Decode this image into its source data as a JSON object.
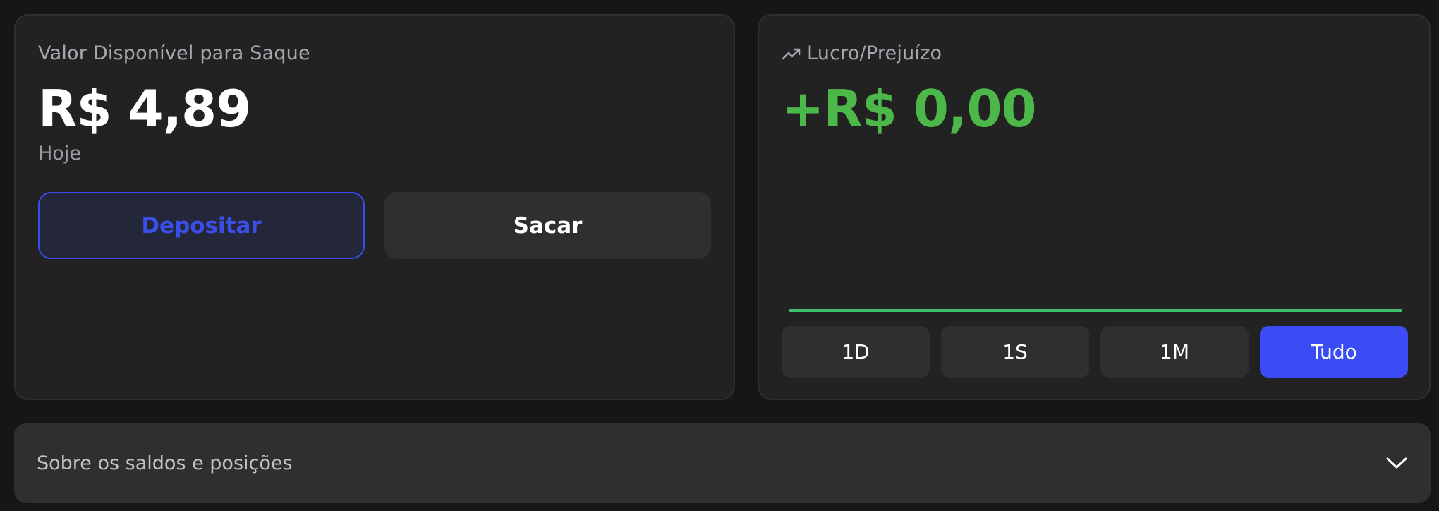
{
  "balance_card": {
    "label": "Valor Disponível para Saque",
    "value": "R$ 4,89",
    "period": "Hoje",
    "deposit_label": "Depositar",
    "withdraw_label": "Sacar"
  },
  "pnl_card": {
    "label": "Lucro/Prejuízo",
    "icon": "trend-up-icon",
    "value": "+R$ 0,00",
    "value_color": "#4db84a",
    "ranges": [
      "1D",
      "1S",
      "1M",
      "Tudo"
    ],
    "active_range": "Tudo",
    "line_color": "#3fbf6f"
  },
  "chart_data": {
    "type": "line",
    "series": [
      {
        "values": [
          0,
          0
        ]
      }
    ]
  },
  "accordion": {
    "label": "Sobre os saldos e posições",
    "icon": "chevron-down-icon"
  },
  "colors": {
    "accent": "#3b4cf5",
    "positive": "#4db84a",
    "background": "#161616",
    "card": "#222222"
  }
}
